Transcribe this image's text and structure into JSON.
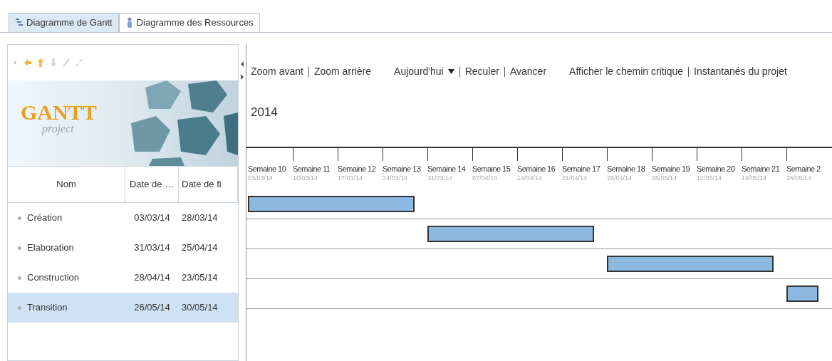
{
  "tabs": [
    {
      "label": "Diagramme de Gantt",
      "selected": true,
      "kind": "gantt"
    },
    {
      "label": "Diagramme des Ressources",
      "selected": false,
      "kind": "resources"
    }
  ],
  "logo": {
    "brand": "GANTT",
    "sub": "project"
  },
  "task_table": {
    "columns": [
      "Nom",
      "Date de …",
      "Date de fi"
    ],
    "rows": [
      {
        "name": "Création",
        "start": "03/03/14",
        "end": "28/03/14",
        "selected": false
      },
      {
        "name": "Elaboration",
        "start": "31/03/14",
        "end": "25/04/14",
        "selected": false
      },
      {
        "name": "Construction",
        "start": "28/04/14",
        "end": "23/05/14",
        "selected": false
      },
      {
        "name": "Transition",
        "start": "26/05/14",
        "end": "30/05/14",
        "selected": true
      }
    ]
  },
  "chart_toolbar": [
    [
      {
        "label": "Zoom avant"
      },
      {
        "label": "Zoom arrière"
      }
    ],
    [
      {
        "label": "Aujourd'hui",
        "kind": "dropdown"
      },
      {
        "label": "Reculer"
      },
      {
        "label": "Avancer"
      }
    ],
    [
      {
        "label": "Afficher le chemin critique"
      },
      {
        "label": "Instantanés du projet"
      }
    ]
  ],
  "timeline": {
    "year": "2014",
    "weeks": [
      {
        "label": "Semaine 10",
        "date": "03/03/14"
      },
      {
        "label": "Semaine 11",
        "date": "10/03/14"
      },
      {
        "label": "Semaine 12",
        "date": "17/03/14"
      },
      {
        "label": "Semaine 13",
        "date": "24/03/14"
      },
      {
        "label": "Semaine 14",
        "date": "31/03/14"
      },
      {
        "label": "Semaine 15",
        "date": "07/04/14"
      },
      {
        "label": "Semaine 16",
        "date": "14/04/14"
      },
      {
        "label": "Semaine 17",
        "date": "21/04/14"
      },
      {
        "label": "Semaine 18",
        "date": "28/04/14"
      },
      {
        "label": "Semaine 19",
        "date": "05/05/14"
      },
      {
        "label": "Semaine 20",
        "date": "12/05/14"
      },
      {
        "label": "Semaine 21",
        "date": "19/05/14"
      },
      {
        "label": "Semaine 2",
        "date": "26/05/14"
      }
    ]
  }
}
